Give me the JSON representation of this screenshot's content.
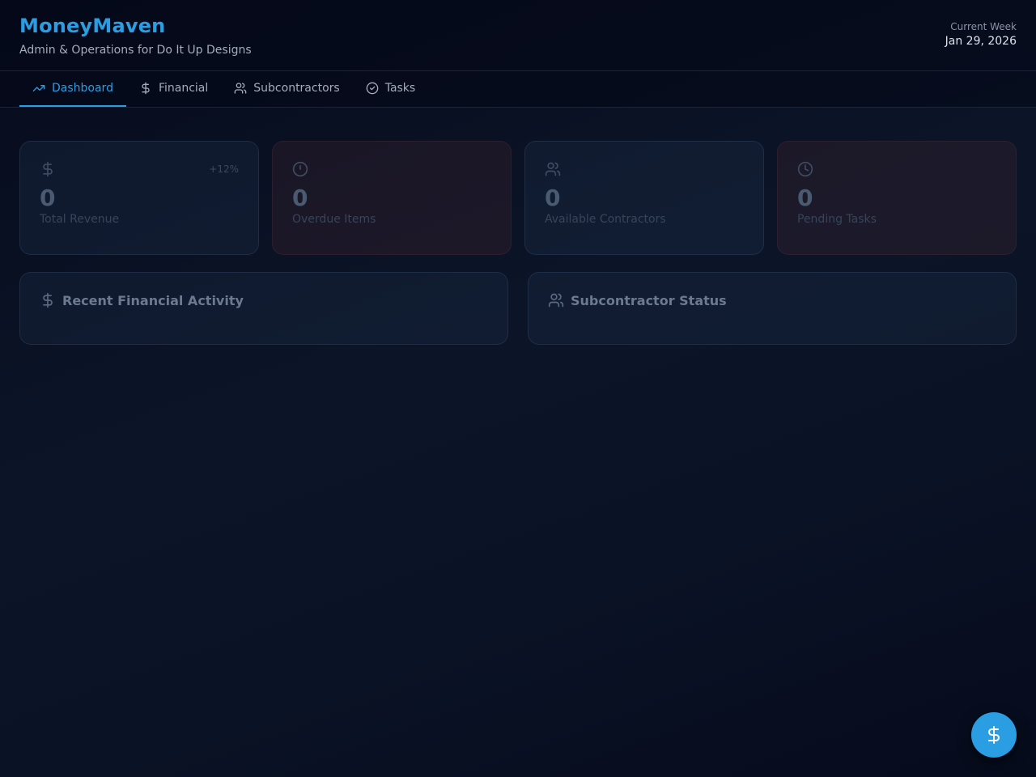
{
  "header": {
    "title": "MoneyMaven",
    "subtitle": "Admin & Operations for Do It Up Designs",
    "week_label": "Current Week",
    "week_date": "Jan 29, 2026"
  },
  "nav": {
    "tabs": [
      {
        "label": "Dashboard",
        "icon": "trending-up-icon",
        "active": true
      },
      {
        "label": "Financial",
        "icon": "dollar-icon",
        "active": false
      },
      {
        "label": "Subcontractors",
        "icon": "users-icon",
        "active": false
      },
      {
        "label": "Tasks",
        "icon": "check-circle-icon",
        "active": false
      }
    ]
  },
  "stats": [
    {
      "icon": "dollar-icon",
      "value": "0",
      "label": "Total Revenue",
      "change": "+12%",
      "tone": "blue"
    },
    {
      "icon": "alert-circle-icon",
      "value": "0",
      "label": "Overdue Items",
      "tone": "red"
    },
    {
      "icon": "users-icon",
      "value": "0",
      "label": "Available Contractors",
      "tone": "blue"
    },
    {
      "icon": "clock-icon",
      "value": "0",
      "label": "Pending Tasks",
      "tone": "red"
    }
  ],
  "panels": [
    {
      "title": "Recent Financial Activity",
      "icon": "dollar-icon"
    },
    {
      "title": "Subcontractor Status",
      "icon": "users-icon"
    }
  ],
  "fab": {
    "icon": "dollar-icon"
  },
  "colors": {
    "accent": "#2b9ee3",
    "background": "#0a1225"
  }
}
